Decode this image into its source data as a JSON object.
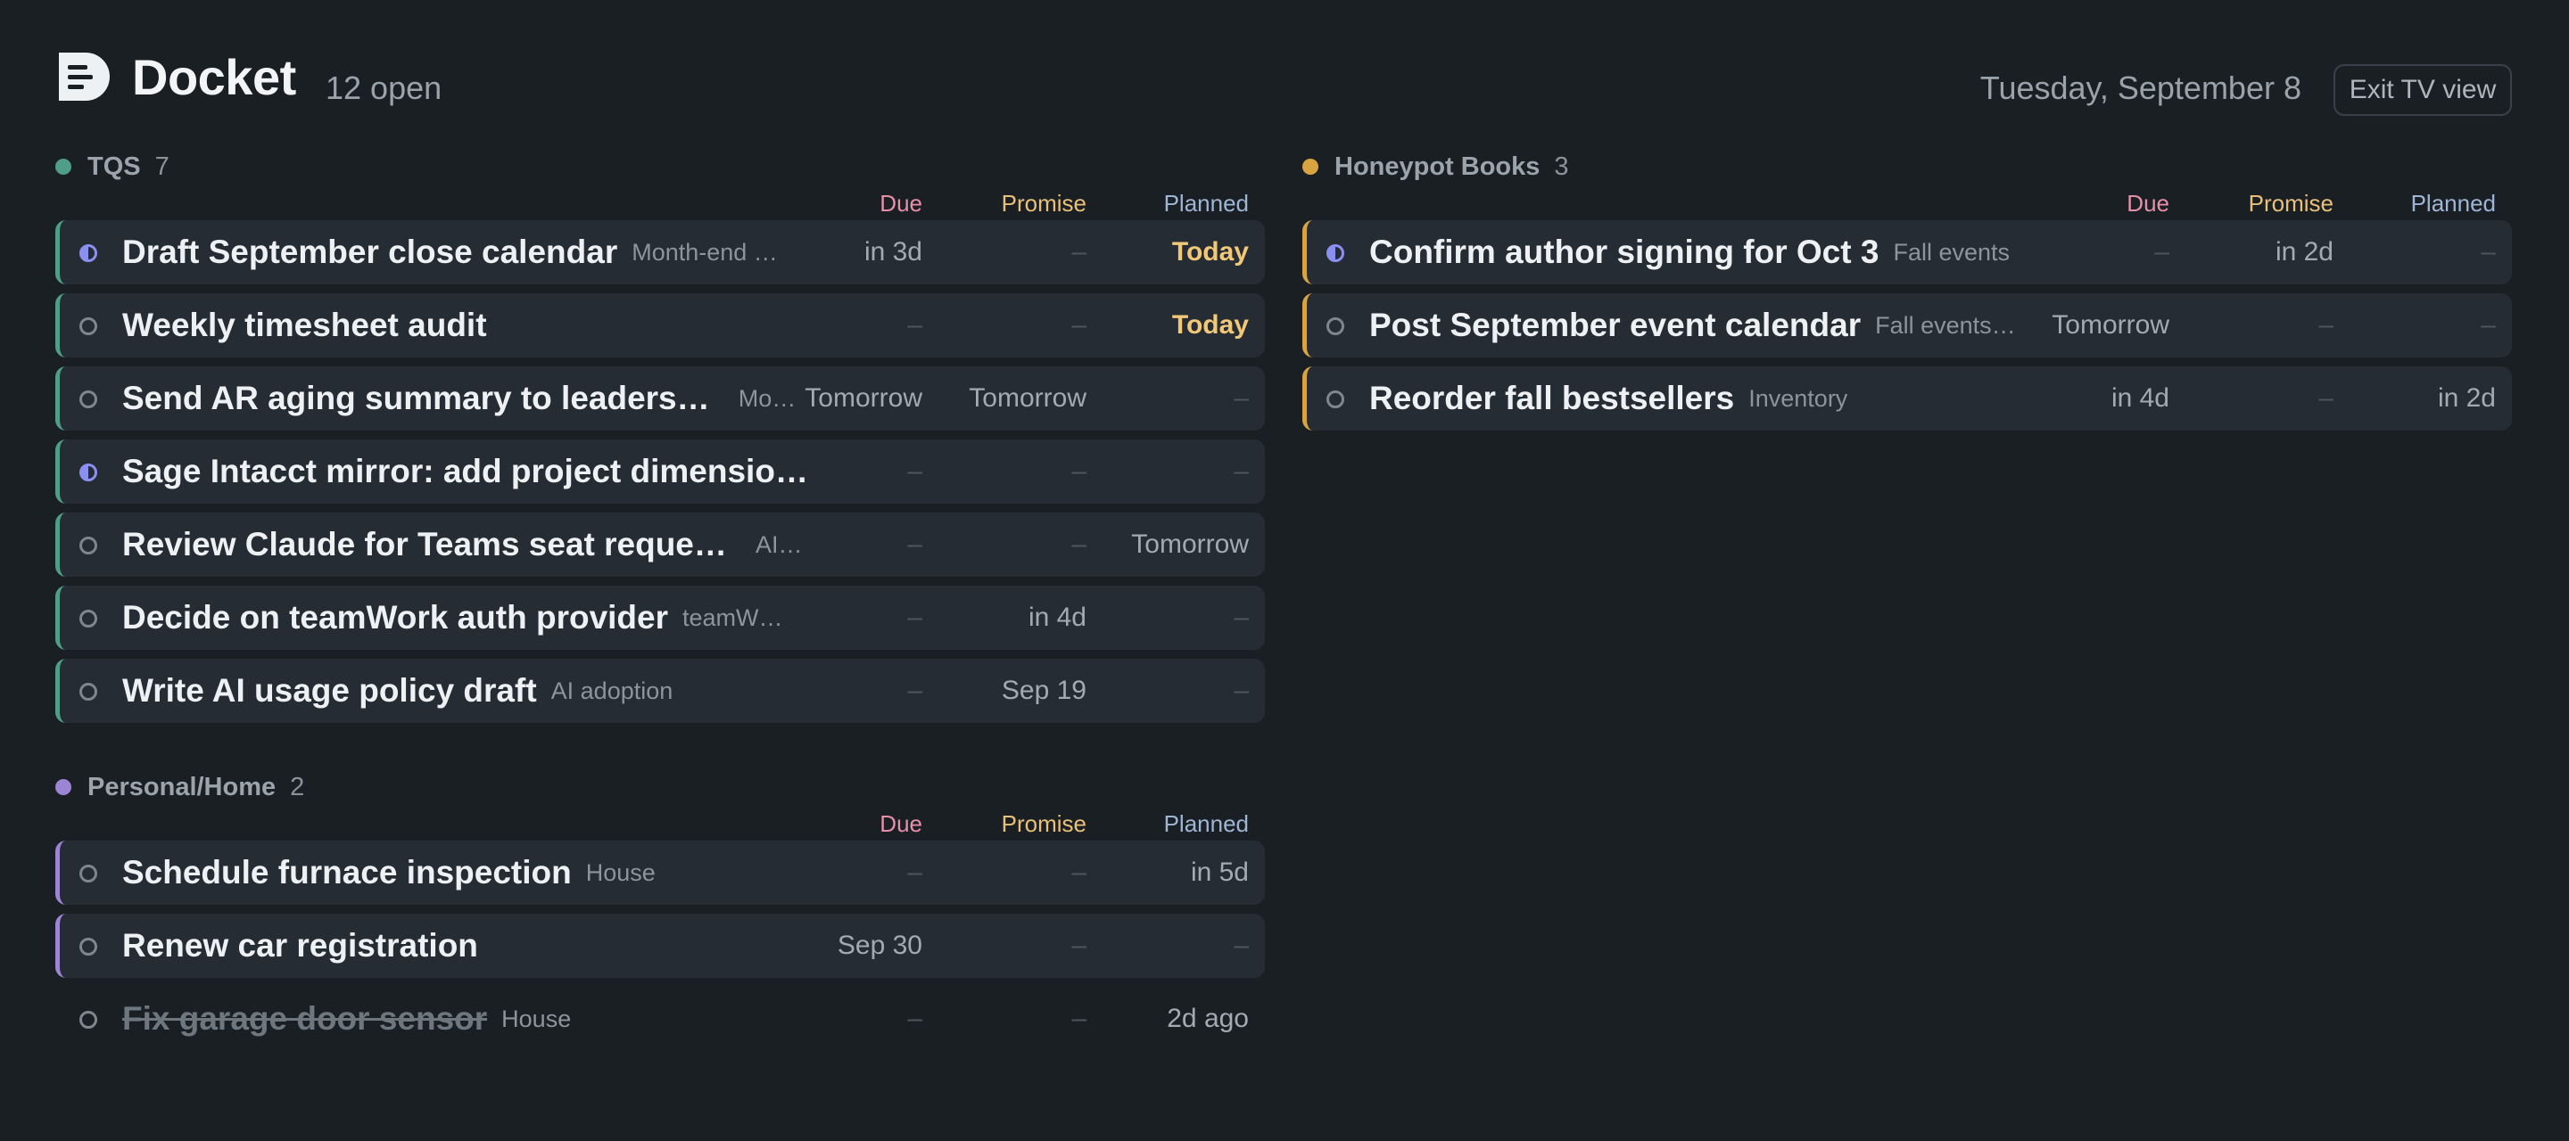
{
  "header": {
    "app_title": "Docket",
    "open_count": "12 open",
    "date": "Tuesday, September 8",
    "exit_label": "Exit TV view"
  },
  "columns": {
    "due": "Due",
    "promise": "Promise",
    "planned": "Planned"
  },
  "colors": {
    "background": "#1a1f24",
    "tqs": "#4e9e88",
    "personal": "#9b85d4",
    "honeypot": "#d8a442",
    "today": "#f0c878",
    "in_progress": "#8a8ff0"
  },
  "groups": [
    {
      "name": "TQS",
      "count": "7",
      "tasks": [
        {
          "title": "Draft September close calendar",
          "tag": "Month-end …",
          "due": "in 3d",
          "promise": "–",
          "planned": "Today",
          "status": "in-progress"
        },
        {
          "title": "Weekly timesheet audit",
          "tag": "",
          "due": "–",
          "promise": "–",
          "planned": "Today",
          "status": "open"
        },
        {
          "title": "Send AR aging summary to leadership",
          "tag": "Mon…",
          "due": "Tomorrow",
          "promise": "Tomorrow",
          "planned": "–",
          "status": "open"
        },
        {
          "title": "Sage Intacct mirror: add project dimensio…",
          "tag": "",
          "due": "–",
          "promise": "–",
          "planned": "–",
          "status": "in-progress"
        },
        {
          "title": "Review Claude for Teams seat requests",
          "tag": "AI …",
          "due": "–",
          "promise": "–",
          "planned": "Tomorrow",
          "status": "open"
        },
        {
          "title": "Decide on teamWork auth provider",
          "tag": "teamW…",
          "due": "–",
          "promise": "in 4d",
          "planned": "–",
          "status": "open"
        },
        {
          "title": "Write AI usage policy draft",
          "tag": "AI adoption",
          "due": "–",
          "promise": "Sep 19",
          "planned": "–",
          "status": "open"
        }
      ]
    },
    {
      "name": "Personal/Home",
      "count": "2",
      "tasks": [
        {
          "title": "Schedule furnace inspection",
          "tag": "House",
          "due": "–",
          "promise": "–",
          "planned": "in 5d",
          "status": "open"
        },
        {
          "title": "Renew car registration",
          "tag": "",
          "due": "Sep 30",
          "promise": "–",
          "planned": "–",
          "status": "open"
        },
        {
          "title": "Fix garage door sensor",
          "tag": "House",
          "due": "–",
          "promise": "–",
          "planned": "2d ago",
          "status": "done"
        }
      ]
    },
    {
      "name": "Honeypot Books",
      "count": "3",
      "tasks": [
        {
          "title": "Confirm author signing for Oct 3",
          "tag": "Fall events",
          "due": "–",
          "promise": "in 2d",
          "planned": "–",
          "status": "in-progress"
        },
        {
          "title": "Post September event calendar",
          "tag": "Fall events…",
          "due": "Tomorrow",
          "promise": "–",
          "planned": "–",
          "status": "open"
        },
        {
          "title": "Reorder fall bestsellers",
          "tag": "Inventory",
          "due": "in 4d",
          "promise": "–",
          "planned": "in 2d",
          "status": "open"
        }
      ]
    }
  ]
}
